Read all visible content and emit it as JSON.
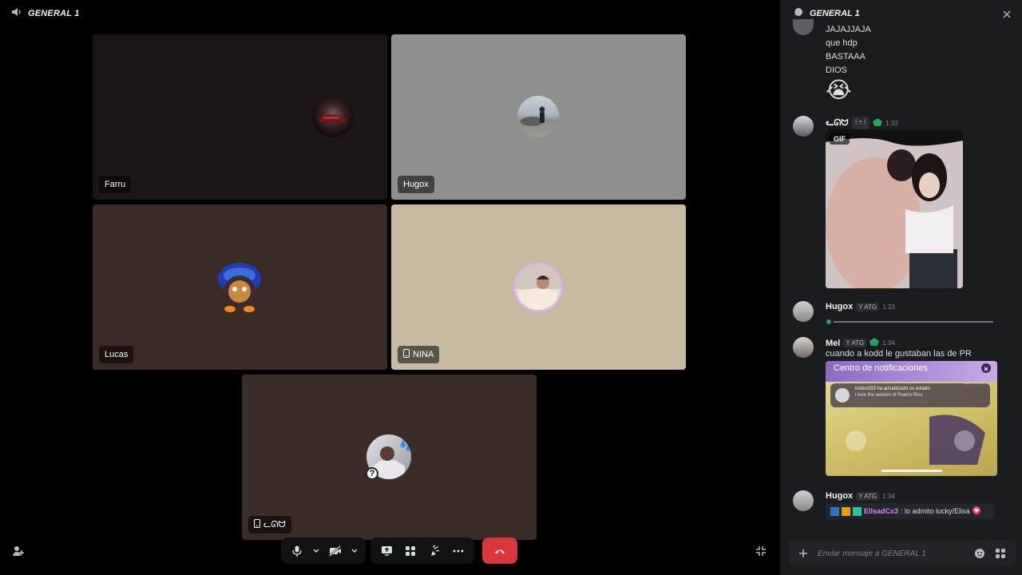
{
  "voice": {
    "channel_title": "GENERAL 1",
    "participants": [
      {
        "name": "Farru",
        "mobile": false,
        "bg": "#1c1616"
      },
      {
        "name": "Hugox",
        "mobile": false,
        "bg": "#8e9090"
      },
      {
        "name": "Lucas",
        "mobile": false,
        "bg": "#3a2c25"
      },
      {
        "name": "NINA",
        "mobile": true,
        "bg": "#c8b9a1"
      },
      {
        "name": "ᓚᘏᗢ",
        "mobile": true,
        "bg": "#3a2c27"
      }
    ],
    "unknown_badge": "?"
  },
  "chat": {
    "title": "GENERAL 1",
    "earlier_lines": [
      "JAJAJJAJA",
      "que hdp",
      "BASTAAA",
      "DIOS"
    ],
    "emoji": "😭",
    "messages": [
      {
        "author": "ᓚᘏᗢ",
        "tag": "꒰ৎ꒱",
        "time": "1:33",
        "attachment": "GIF"
      },
      {
        "author": "Hugox",
        "tag": "Y ATG",
        "time": "1:33"
      },
      {
        "author": "Mel",
        "tag": "Y ATG",
        "time": "1:34",
        "text": "cuando a kodd le gustaban las de PR",
        "screenshot": {
          "title": "Centro de notificaciones",
          "time": "Hace 19 min",
          "line1": "kodxx333 ha actualizado su estado",
          "line2": "i love the women of Puerto Rico"
        }
      },
      {
        "author": "Hugox",
        "tag": "Y ATG",
        "time": "1:34",
        "status_user": "EllsadCx3",
        "status_text": ": lo admito lucky/Elisa"
      }
    ],
    "composer_placeholder": "Enviar mensaje a GENERAL 1"
  },
  "colors": {
    "danger": "#da373c",
    "accent_green": "#23a55a",
    "status_pink": "#d880ff"
  }
}
